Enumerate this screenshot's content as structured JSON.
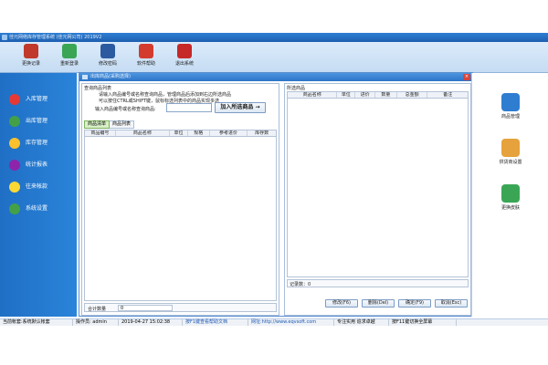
{
  "window": {
    "title": "佳元网络库存管理系统 (佳元网公司) 2019V2"
  },
  "toolbar": [
    {
      "label": "更换记录",
      "color": "#c0392b"
    },
    {
      "label": "重新登录",
      "color": "#3aa655"
    },
    {
      "label": "修改密码",
      "color": "#2c5aa0"
    },
    {
      "label": "软件帮助",
      "color": "#d33b2f"
    },
    {
      "label": "退出系统",
      "color": "#c62828"
    }
  ],
  "sidebar": [
    {
      "label": "入库管理",
      "icon": "arrow-right-icon",
      "color": "#e53935"
    },
    {
      "label": "出库管理",
      "icon": "plus-icon",
      "color": "#43a047"
    },
    {
      "label": "库存管理",
      "icon": "star-icon",
      "color": "#fbc02d"
    },
    {
      "label": "统计报表",
      "icon": "bar-chart-icon",
      "color": "#8e24aa"
    },
    {
      "label": "往来帐款",
      "icon": "dollar-icon",
      "color": "#fdd835"
    },
    {
      "label": "系统设置",
      "icon": "gear-icon",
      "color": "#43a047"
    }
  ],
  "dialog": {
    "title": "出库商品(采购选择)",
    "close": "×",
    "left": {
      "heading": "查询商品列表",
      "hint1": "请输入商品编号或名称查询商品，管理商品后添加到右边所选商品",
      "hint2": "可以按住CTRL或SHIFT键，鼠标标选列表中的商品实现多选",
      "search_label": "输入商品编号或名称查询商品:",
      "search_value": "",
      "add_button": "加入所选商品",
      "tabs": [
        "商品清单",
        "商品列表"
      ],
      "columns": [
        "商品编号",
        "商品名称",
        "单位",
        "规格",
        "参考进价",
        "库存数"
      ],
      "total_label": "合计数量",
      "total_value": "0"
    },
    "right": {
      "heading": "所选商品",
      "columns": [
        "商品名称",
        "单位",
        "进价",
        "数量",
        "总金额",
        "备注"
      ],
      "record_label": "记录数：0",
      "buttons": [
        "修改(F6)",
        "删除(Del)",
        "确定(F9)",
        "取消(Esc)"
      ]
    }
  },
  "rightbar": [
    {
      "label": "商品管理",
      "icon": "register-icon"
    },
    {
      "label": "供货商设置",
      "icon": "people-icon"
    },
    {
      "label": "更换皮肤",
      "icon": "cubes-icon"
    }
  ],
  "status": [
    "当前帐套:系统默认帐套",
    "操作员: admin",
    "2019-04-27 15:02:38",
    "按F1键查看帮助文档",
    "网址:http://www.eqvsoft.com",
    "专注实用 追求卓越",
    "按F11键切换全屏幕"
  ]
}
